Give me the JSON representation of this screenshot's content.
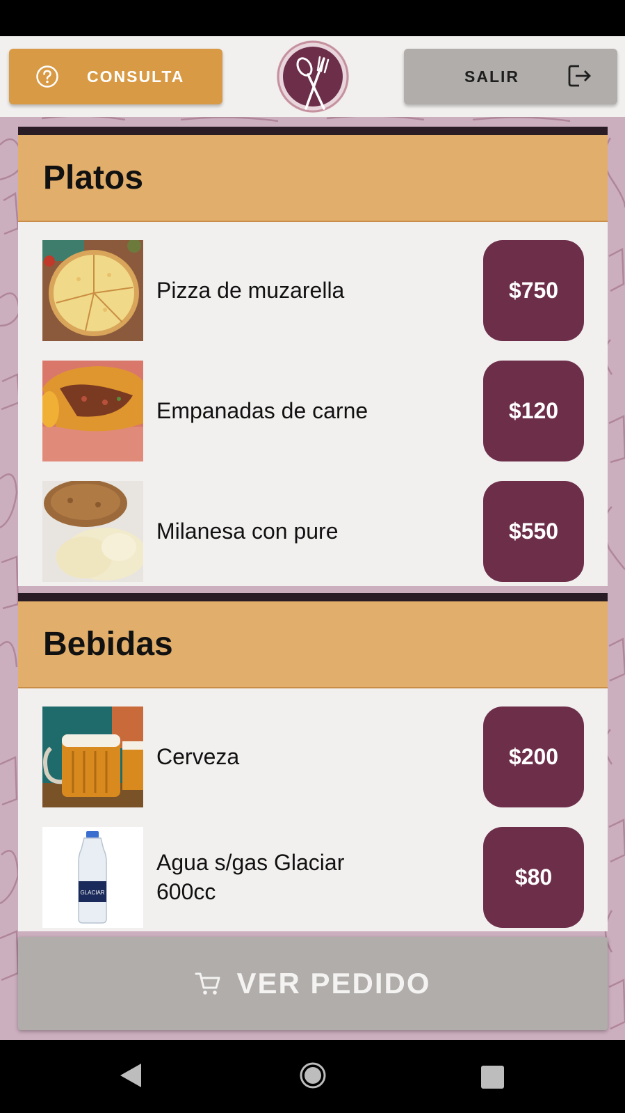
{
  "header": {
    "consulta_label": "CONSULTA",
    "salir_label": "SALIR"
  },
  "sections": [
    {
      "title": "Platos",
      "items": [
        {
          "name": "Pizza de muzarella",
          "price": "$750",
          "image": "pizza-image"
        },
        {
          "name": "Empanadas de carne",
          "price": "$120",
          "image": "empanadas-image"
        },
        {
          "name": "Milanesa con pure",
          "price": "$550",
          "image": "milanesa-image"
        }
      ]
    },
    {
      "title": "Bebidas",
      "items": [
        {
          "name": "Cerveza",
          "price": "$200",
          "image": "beer-image"
        },
        {
          "name": "Agua s/gas Glaciar 600cc",
          "price": "$80",
          "image": "water-bottle-image"
        }
      ]
    }
  ],
  "footer": {
    "ver_pedido_label": "VER PEDIDO"
  },
  "bottle_label": "GLACIAR",
  "colors": {
    "accent_orange": "#d99a45",
    "section_header": "#e2ae6b",
    "price_button": "#6d2e4a",
    "gray_button": "#b0adab",
    "background_pattern": "#ccafbf"
  },
  "icons": {
    "consulta": "question-circle-icon",
    "salir": "logout-icon",
    "logo": "spoon-fork-logo-icon",
    "ver_pedido": "cart-icon"
  }
}
